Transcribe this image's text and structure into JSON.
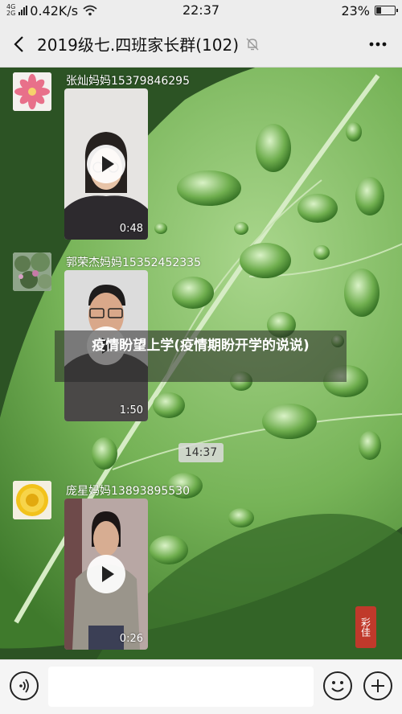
{
  "status_bar": {
    "network_top": "4G",
    "network_bottom": "2G",
    "speed": "0.42K/s",
    "time": "22:37",
    "battery": "23%",
    "battery_level": 0.23
  },
  "nav": {
    "title": "2019级七.四班家长群(102)",
    "back_icon": "chevron-left-icon",
    "mute_icon": "bell-muted-icon",
    "more_icon": "more-dots-icon"
  },
  "messages": [
    {
      "sender": "张灿妈妈15379846295",
      "type": "video",
      "duration": "0:48",
      "avatar_icon": "pink-flower-avatar"
    },
    {
      "sender": "郭荣杰妈妈15352452335",
      "type": "video",
      "duration": "1:50",
      "avatar_icon": "garden-avatar"
    },
    {
      "sender": "庞星妈妈13893895530",
      "type": "video",
      "duration": "0:26",
      "avatar_icon": "yellow-flower-avatar"
    }
  ],
  "time_separator": "14:37",
  "overlay_caption": "疫情盼望上学(疫情期盼开学的说说)",
  "seal_text": "彩佳",
  "input_bar": {
    "voice_icon": "voice-icon",
    "emoji_icon": "emoji-icon",
    "plus_icon": "plus-icon"
  }
}
